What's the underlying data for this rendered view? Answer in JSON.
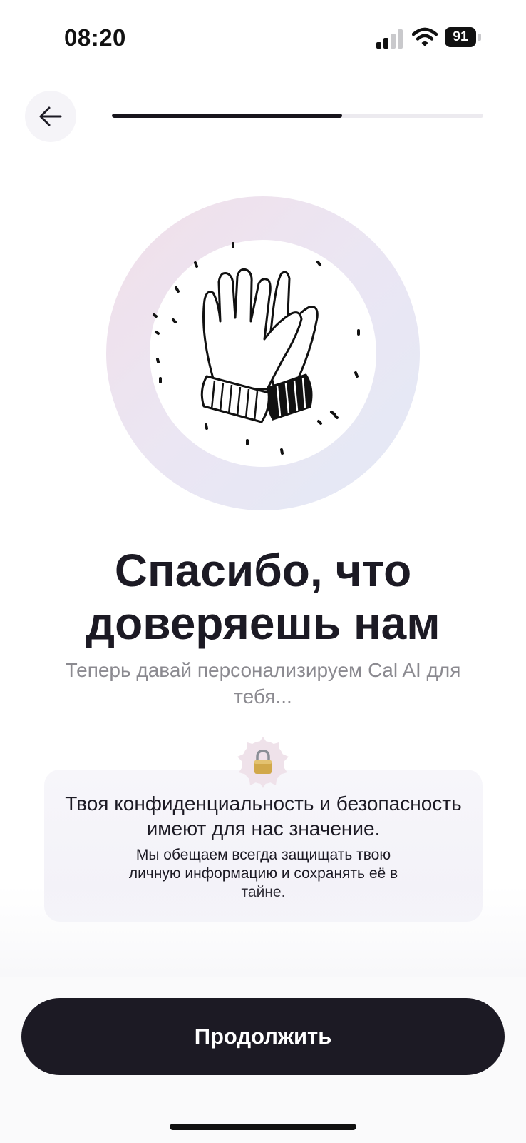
{
  "status_bar": {
    "time": "08:20",
    "battery": "91",
    "icons": [
      "cellular-signal-icon",
      "wifi-icon",
      "battery-icon"
    ]
  },
  "header": {
    "back_icon": "arrow-left-icon",
    "progress_fraction": 0.62
  },
  "illustration": {
    "icon": "high-five-gloves-icon",
    "colors": {
      "ring_start": "#f1dfe9",
      "ring_end": "#e3e9f6"
    }
  },
  "content": {
    "title": "Спасибо, что доверяешь нам",
    "subtitle": "Теперь давай персонализируем Cal AI для тебя..."
  },
  "privacy_card": {
    "icon": "lock-icon",
    "title": "Твоя конфиденциальность и безопасность имеют для нас значение.",
    "body": "Мы обещаем всегда защищать твою личную информацию и сохранять её в тайне."
  },
  "footer": {
    "continue_label": "Продолжить"
  },
  "colors": {
    "primary": "#1c1a24",
    "muted_text": "#8b8a90",
    "card_bg": "#f4f3f8"
  }
}
